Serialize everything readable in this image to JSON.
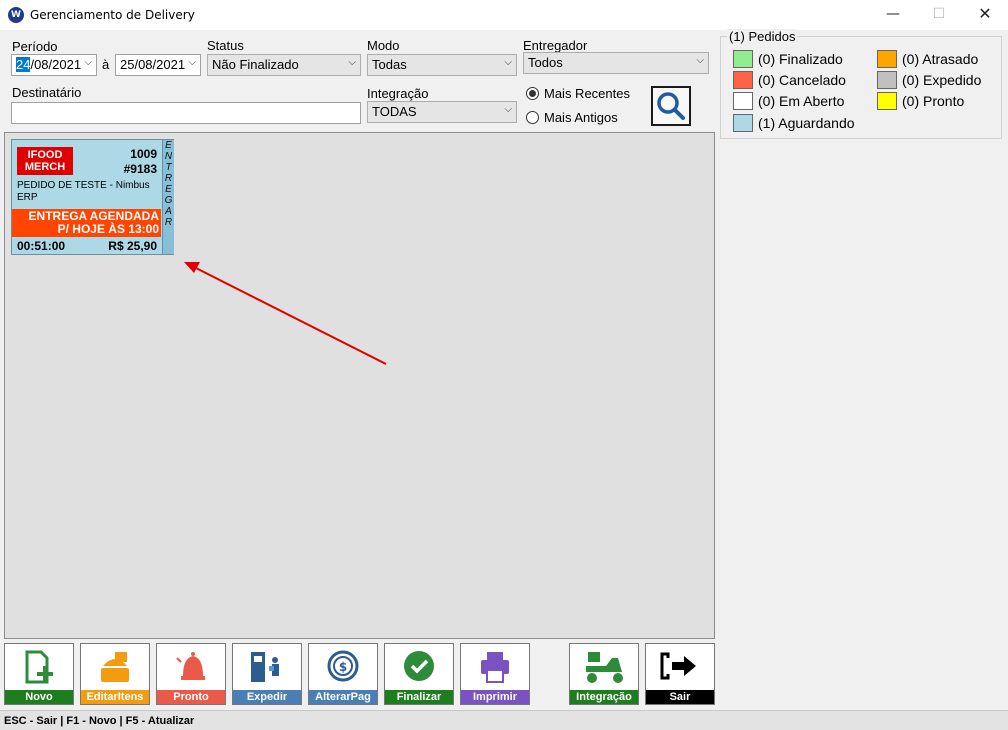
{
  "window": {
    "title": "Gerenciamento de Delivery",
    "min_glyph": "—",
    "max_glyph": "☐",
    "close_glyph": "✕",
    "icon_text": "W"
  },
  "filters": {
    "periodo_label": "Período",
    "date_from_day": "24",
    "date_from_rest": "/08/2021",
    "date_sep": "à",
    "date_to": "25/08/2021",
    "status_label": "Status",
    "status_value": "Não Finalizado",
    "modo_label": "Modo",
    "modo_value": "Todas",
    "entregador_label": "Entregador",
    "entregador_value": "Todos",
    "destinatario_label": "Destinatário",
    "destinatario_value": "",
    "integracao_label": "Integração",
    "integracao_value": "TODAS",
    "sort_recent": "Mais Recentes",
    "sort_old": "Mais Antigos",
    "sort_selected": "recent"
  },
  "legend": {
    "title": "(1) Pedidos",
    "items": [
      {
        "label": "(0) Finalizado",
        "color": "#90ee90"
      },
      {
        "label": "(0) Cancelado",
        "color": "#ff6347"
      },
      {
        "label": "(0) Em Aberto",
        "color": "#ffffff"
      },
      {
        "label": "(1) Aguardando",
        "color": "#add8e6"
      },
      {
        "label": "(0) Atrasado",
        "color": "#ffa500"
      },
      {
        "label": "(0) Expedido",
        "color": "#c0c0c0"
      },
      {
        "label": "(0) Pronto",
        "color": "#ffff00"
      }
    ]
  },
  "order": {
    "source_line1": "IFOOD",
    "source_line2": "MERCH",
    "number": "1009",
    "code": "#9183",
    "description": "PEDIDO DE TESTE - Nimbus ERP",
    "schedule_line1": "ENTREGA AGENDADA",
    "schedule_line2": "P/ HOJE ÀS 13:00",
    "elapsed": "00:51:00",
    "price": "R$ 25,90",
    "side_letters": [
      "E",
      "N",
      "T",
      "R",
      "E",
      "G",
      "A",
      "R"
    ],
    "color": "#add8e6"
  },
  "toolbar": [
    {
      "label": "Novo",
      "color": "#1e7d1e",
      "icon": "new-document-icon"
    },
    {
      "label": "EditarItens",
      "color": "#f39c12",
      "icon": "edit-items-icon"
    },
    {
      "label": "Pronto",
      "color": "#ea5a4b",
      "icon": "ready-bell-icon"
    },
    {
      "label": "Expedir",
      "color": "#4a7fb5",
      "icon": "dispatch-icon"
    },
    {
      "label": "AlterarPag",
      "color": "#4a7fb5",
      "icon": "change-payment-icon"
    },
    {
      "label": "Finalizar",
      "color": "#1e7d1e",
      "icon": "finalize-check-icon"
    },
    {
      "label": "Imprimir",
      "color": "#7b52c1",
      "icon": "printer-icon"
    },
    {
      "label": "Integração",
      "color": "#1e7d1e",
      "icon": "delivery-scooter-icon"
    },
    {
      "label": "Sair",
      "color": "#000000",
      "icon": "exit-icon"
    }
  ],
  "statusbar": {
    "text": "ESC - Sair | F1 - Novo | F5 - Atualizar"
  }
}
